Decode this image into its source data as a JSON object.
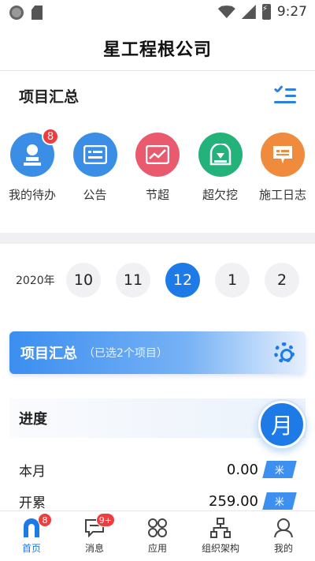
{
  "status_bar": {
    "time": "9:27"
  },
  "header": {
    "title": "星工程根公司"
  },
  "summary_section": {
    "title": "项目汇总",
    "action_icon": "checklist-icon"
  },
  "quick_actions": [
    {
      "label": "我的待办",
      "icon": "todo-icon",
      "color": "#3a8ee6",
      "badge": "8"
    },
    {
      "label": "公告",
      "icon": "announcement-icon",
      "color": "#3a8ee6",
      "badge": ""
    },
    {
      "label": "节超",
      "icon": "chart-icon",
      "color": "#ea5a6e",
      "badge": ""
    },
    {
      "label": "超欠挖",
      "icon": "excavation-icon",
      "color": "#23b27a",
      "badge": ""
    },
    {
      "label": "施工日志",
      "icon": "log-icon",
      "color": "#f08a3c",
      "badge": ""
    }
  ],
  "month_picker": {
    "year": "2020年",
    "months": [
      "10",
      "11",
      "12",
      "1",
      "2"
    ],
    "selected": "12"
  },
  "project_bar": {
    "title": "项目汇总",
    "subtitle": "（已选2个项目）",
    "icon": "gear-icon"
  },
  "progress": {
    "title": "进度",
    "period_button": "月",
    "rows": [
      {
        "label": "本月",
        "value": "0.00",
        "unit": "米"
      },
      {
        "label": "开累",
        "value": "259.00",
        "unit": "米"
      }
    ]
  },
  "bottom_nav": [
    {
      "label": "首页",
      "icon": "home-icon",
      "badge": "8",
      "active": true
    },
    {
      "label": "消息",
      "icon": "message-icon",
      "badge": "9+",
      "active": false
    },
    {
      "label": "应用",
      "icon": "apps-icon",
      "badge": "",
      "active": false
    },
    {
      "label": "组织架构",
      "icon": "org-chart-icon",
      "badge": "",
      "active": false
    },
    {
      "label": "我的",
      "icon": "profile-icon",
      "badge": "",
      "active": false
    }
  ],
  "colors": {
    "accent": "#1e7ae6",
    "badge": "#ef3c3c"
  }
}
